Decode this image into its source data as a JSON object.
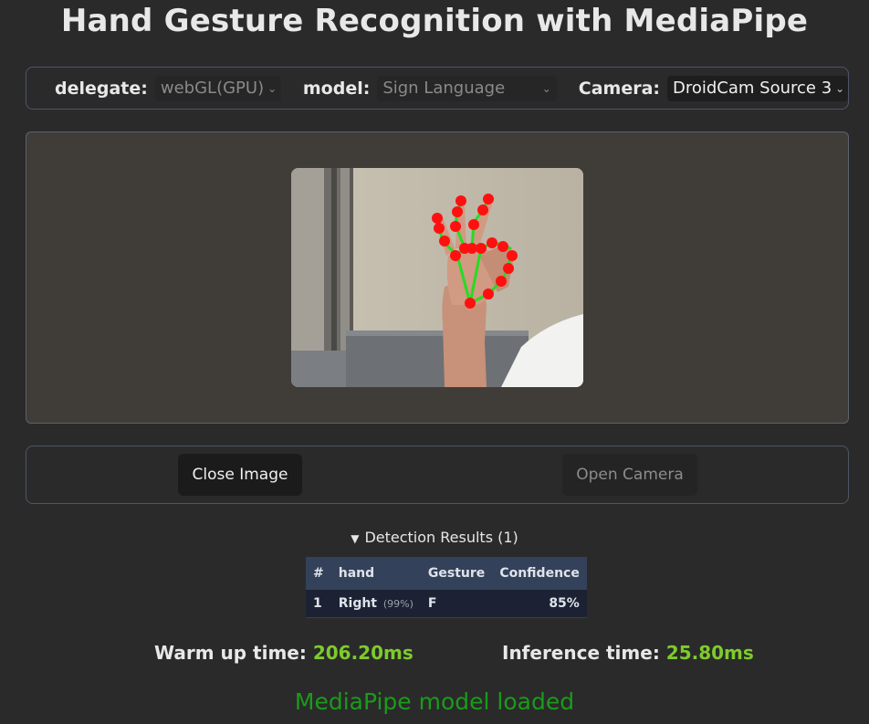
{
  "title": "Hand Gesture Recognition with MediaPipe",
  "controls": {
    "delegate_label": "delegate:",
    "delegate_value": "webGL(GPU)",
    "model_label": "model:",
    "model_value": "Sign Language",
    "camera_label": "Camera:",
    "camera_value": "DroidCam Source 3"
  },
  "image": {
    "description": "camera frame with hand landmarks",
    "landmark_color": "#ff0000",
    "connection_color": "#22dd22"
  },
  "buttons": {
    "close_label": "Close Image",
    "open_label": "Open Camera"
  },
  "results": {
    "summary": "Detection Results (1)",
    "headers": [
      "#",
      "hand",
      "Gesture",
      "Confidence"
    ],
    "rows": [
      {
        "index": "1",
        "hand": "Right",
        "hand_score": "(99%)",
        "gesture": "F",
        "confidence": "85%"
      }
    ]
  },
  "stats": {
    "warmup_label": "Warm up time:",
    "warmup_value": "206.20ms",
    "inference_label": "Inference time:",
    "inference_value": "25.80ms"
  },
  "status": "MediaPipe model loaded",
  "colors": {
    "background": "#2a2a2a",
    "accent_value": "#7ecb2c",
    "status_green": "#1b9a1b",
    "table_header": "#34415a"
  }
}
